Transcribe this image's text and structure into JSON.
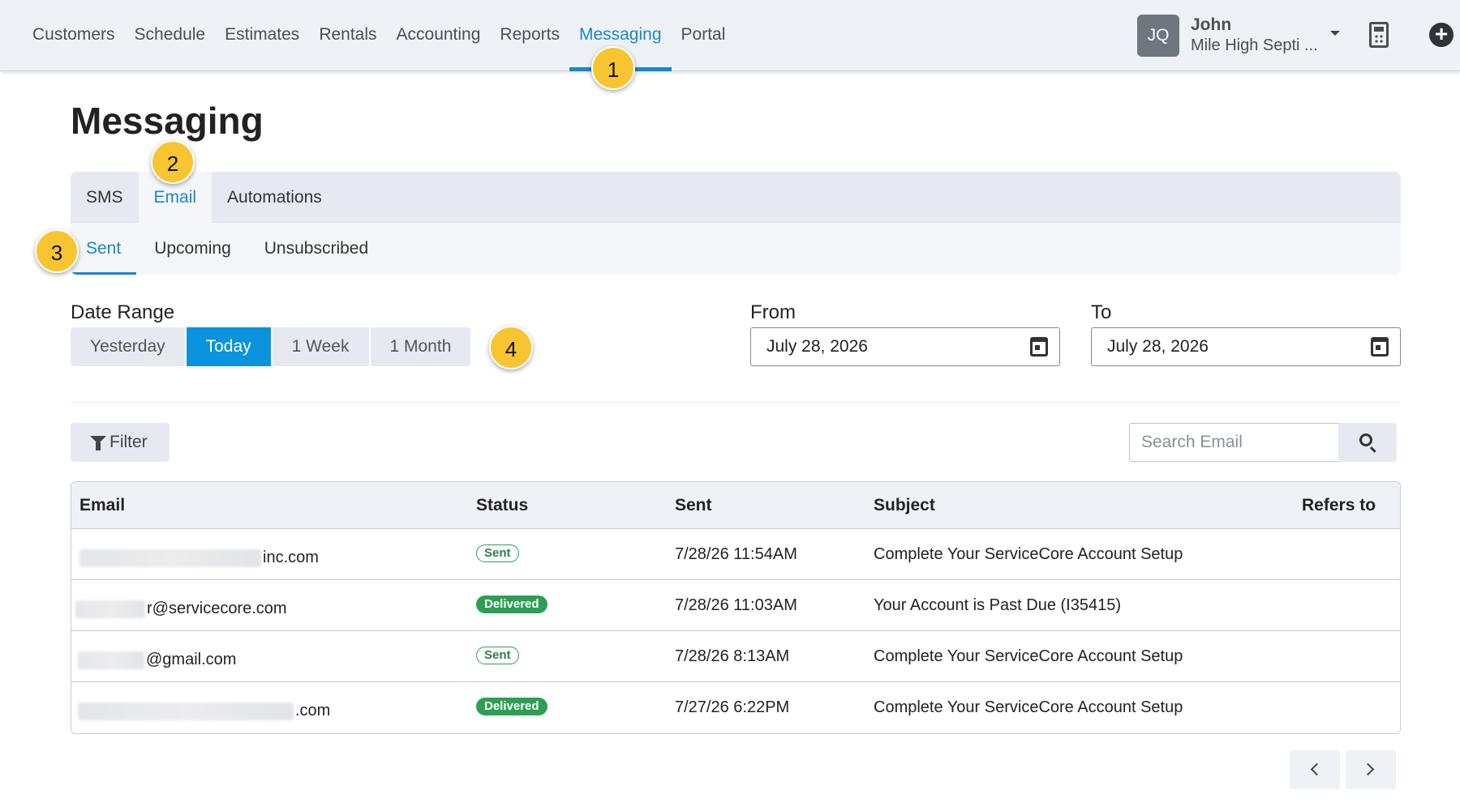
{
  "nav": {
    "items": [
      {
        "label": "Customers",
        "active": false
      },
      {
        "label": "Schedule",
        "active": false
      },
      {
        "label": "Estimates",
        "active": false
      },
      {
        "label": "Rentals",
        "active": false
      },
      {
        "label": "Accounting",
        "active": false
      },
      {
        "label": "Reports",
        "active": false
      },
      {
        "label": "Messaging",
        "active": true
      },
      {
        "label": "Portal",
        "active": false
      }
    ],
    "accent_color": "#1a87c9"
  },
  "user": {
    "initials": "JQ",
    "name": "John",
    "company": "Mile High Septi ..."
  },
  "icons": {
    "dropdown": "caret-down-icon",
    "calculator": "calculator-icon",
    "add": "plus-circle-icon",
    "calendar": "calendar-icon",
    "filter": "funnel-icon",
    "search": "search-icon",
    "prev": "chevron-left-icon",
    "next": "chevron-right-icon"
  },
  "badges": [
    "1",
    "2",
    "3",
    "4"
  ],
  "page": {
    "title": "Messaging"
  },
  "tabs": [
    {
      "label": "SMS",
      "active": false
    },
    {
      "label": "Email",
      "active": true
    },
    {
      "label": "Automations",
      "active": false
    }
  ],
  "subtabs": [
    {
      "label": "Sent",
      "active": true
    },
    {
      "label": "Upcoming",
      "active": false
    },
    {
      "label": "Unsubscribed",
      "active": false
    }
  ],
  "date_range": {
    "label": "Date Range",
    "options": [
      {
        "label": "Yesterday",
        "active": false
      },
      {
        "label": "Today",
        "active": true
      },
      {
        "label": "1 Week",
        "active": false
      },
      {
        "label": "1 Month",
        "active": false
      }
    ],
    "active_color": "#0a93dc"
  },
  "from": {
    "label": "From",
    "value": "July 28, 2026"
  },
  "to": {
    "label": "To",
    "value": "July 28, 2026"
  },
  "filter": {
    "label": "Filter"
  },
  "search": {
    "placeholder": "Search Email"
  },
  "table": {
    "columns": [
      "Email",
      "Status",
      "Sent",
      "Subject",
      "Refers to"
    ],
    "rows": [
      {
        "email_suffix": "inc.com",
        "status": "Sent",
        "sent": "7/28/26 11:54AM",
        "subject": "Complete Your ServiceCore Account Setup",
        "refers_to": ""
      },
      {
        "email_suffix": "r@servicecore.com",
        "status": "Delivered",
        "sent": "7/28/26 11:03AM",
        "subject": "Your Account is Past Due (I35415)",
        "refers_to": ""
      },
      {
        "email_suffix": "@gmail.com",
        "status": "Sent",
        "sent": "7/28/26 8:13AM",
        "subject": "Complete Your ServiceCore Account Setup",
        "refers_to": ""
      },
      {
        "email_suffix": ".com",
        "status": "Delivered",
        "sent": "7/27/26 6:22PM",
        "subject": "Complete Your ServiceCore Account Setup",
        "refers_to": ""
      }
    ],
    "status_color": "#2e9e55"
  }
}
